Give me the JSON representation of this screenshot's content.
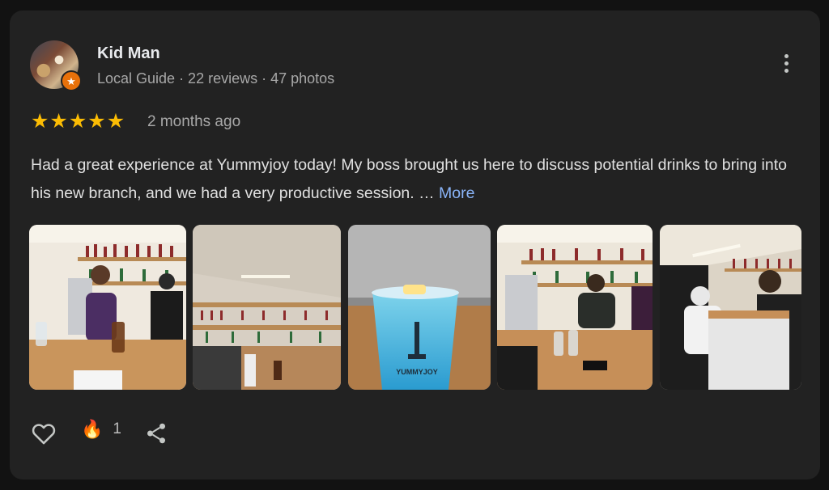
{
  "reviewer": {
    "name": "Kid Man",
    "meta": "Local Guide · 22 reviews · 47 photos",
    "badge_icon": "star"
  },
  "review": {
    "stars": 5,
    "time": "2 months ago",
    "text": "Had a great experience at Yummyjoy today! My boss brought us here to discuss potential drinks to bring into his new branch, and we had a very productive session. … ",
    "more_label": "More"
  },
  "photos": [
    {
      "alt": "smiling man at a bar counter with liquor bottles on shelves"
    },
    {
      "alt": "bar shelves with bottles and counter"
    },
    {
      "alt": "blue drink in a cup with straw"
    },
    {
      "alt": "group meeting at the bar counter"
    },
    {
      "alt": "group of people seated at the counter"
    }
  ],
  "photo_cup_text": "YUMMYJOY",
  "actions": {
    "reaction_count": "1",
    "reaction_emoji": "🔥"
  },
  "colors": {
    "background": "#121212",
    "card": "#222222",
    "star": "#fbbc04",
    "link": "#8ab4f8",
    "badge": "#e8710a"
  }
}
